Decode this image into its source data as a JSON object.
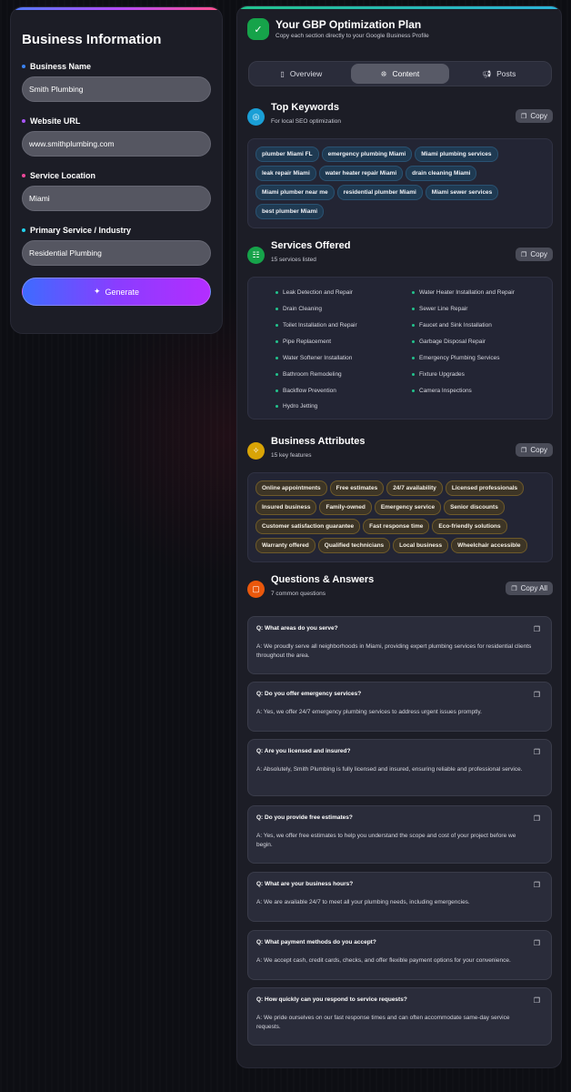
{
  "business_form": {
    "title": "Business Information",
    "fields": [
      {
        "label": "Business Name",
        "value": "Smith Plumbing",
        "dot_color": "#3b82f6"
      },
      {
        "label": "Website URL",
        "value": "www.smithplumbing.com",
        "dot_color": "#a855f7"
      },
      {
        "label": "Service Location",
        "value": "Miami",
        "dot_color": "#ec4899"
      },
      {
        "label": "Primary Service / Industry",
        "value": "Residential Plumbing",
        "dot_color": "#22d3ee"
      }
    ],
    "generate_label": "Generate"
  },
  "plan": {
    "title": "Your GBP Optimization Plan",
    "subtitle": "Copy each section directly to your Google Business Profile",
    "tabs": [
      {
        "label": "Overview",
        "icon": "document-icon"
      },
      {
        "label": "Content",
        "icon": "sparkle-icon",
        "active": true
      },
      {
        "label": "Posts",
        "icon": "megaphone-icon"
      }
    ]
  },
  "keywords": {
    "title": "Top Keywords",
    "subtitle": "For local SEO optimization",
    "copy_label": "Copy",
    "items": [
      "plumber Miami FL",
      "emergency plumbing Miami",
      "Miami plumbing services",
      "leak repair Miami",
      "water heater repair Miami",
      "drain cleaning Miami",
      "Miami plumber near me",
      "residential plumber Miami",
      "Miami sewer services",
      "best plumber Miami"
    ]
  },
  "services": {
    "title": "Services Offered",
    "subtitle": "15 services listed",
    "copy_label": "Copy",
    "items": [
      "Leak Detection and Repair",
      "Water Heater Installation and Repair",
      "Drain Cleaning",
      "Sewer Line Repair",
      "Toilet Installation and Repair",
      "Faucet and Sink Installation",
      "Pipe Replacement",
      "Garbage Disposal Repair",
      "Water Softener Installation",
      "Emergency Plumbing Services",
      "Bathroom Remodeling",
      "Fixture Upgrades",
      "Backflow Prevention",
      "Camera Inspections",
      "Hydro Jetting"
    ]
  },
  "attributes": {
    "title": "Business Attributes",
    "subtitle": "15 key features",
    "copy_label": "Copy",
    "items": [
      "Online appointments",
      "Free estimates",
      "24/7 availability",
      "Licensed professionals",
      "Insured business",
      "Family-owned",
      "Emergency service",
      "Senior discounts",
      "Customer satisfaction guarantee",
      "Fast response time",
      "Eco-friendly solutions",
      "Warranty offered",
      "Qualified technicians",
      "Local business",
      "Wheelchair accessible"
    ]
  },
  "qa": {
    "title": "Questions & Answers",
    "subtitle": "7 common questions",
    "copy_label": "Copy All",
    "items": [
      {
        "q": "Q: What areas do you serve?",
        "a": "A: We proudly serve all neighborhoods in Miami, providing expert plumbing services for residential clients throughout the area."
      },
      {
        "q": "Q: Do you offer emergency services?",
        "a": "A: Yes, we offer 24/7 emergency plumbing services to address urgent issues promptly."
      },
      {
        "q": "Q: Are you licensed and insured?",
        "a": "A: Absolutely, Smith Plumbing is fully licensed and insured, ensuring reliable and professional service."
      },
      {
        "q": "Q: Do you provide free estimates?",
        "a": "A: Yes, we offer free estimates to help you understand the scope and cost of your project before we begin."
      },
      {
        "q": "Q: What are your business hours?",
        "a": "A: We are available 24/7 to meet all your plumbing needs, including emergencies."
      },
      {
        "q": "Q: What payment methods do you accept?",
        "a": "A: We accept cash, credit cards, checks, and offer flexible payment options for your convenience."
      },
      {
        "q": "Q: How quickly can you respond to service requests?",
        "a": "A: We pride ourselves on our fast response times and can often accommodate same-day service requests."
      }
    ]
  }
}
